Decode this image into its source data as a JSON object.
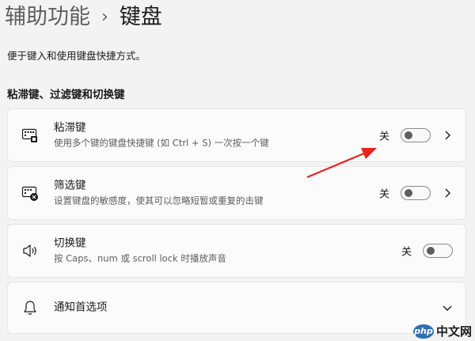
{
  "breadcrumb": {
    "parent": "辅助功能",
    "separator": "›",
    "current": "键盘"
  },
  "description": "便于键入和使用键盘快捷方式。",
  "section_title": "粘滞键、过滤键和切换键",
  "cards": [
    {
      "title": "粘滞键",
      "subtitle": "使用多个键的键盘快捷键 (如 Ctrl + S) 一次按一个键",
      "state": "关",
      "toggle_on": false,
      "icon": "sticky-keys-icon"
    },
    {
      "title": "筛选键",
      "subtitle": "设置键盘的敏感度，使其可以忽略短暂或重复的击键",
      "state": "关",
      "toggle_on": false,
      "icon": "filter-keys-icon"
    },
    {
      "title": "切换键",
      "subtitle": "按 Caps、num 或 scroll lock 时播放声音",
      "state": "关",
      "toggle_on": false,
      "icon": "speaker-icon"
    },
    {
      "title": "通知首选项",
      "icon": "bell-icon"
    }
  ],
  "watermark": {
    "badge": "php",
    "text": "中文网"
  },
  "colors": {
    "background": "#f3f3f3",
    "card": "#fbfbfb",
    "annotation_arrow": "#e8231b"
  }
}
